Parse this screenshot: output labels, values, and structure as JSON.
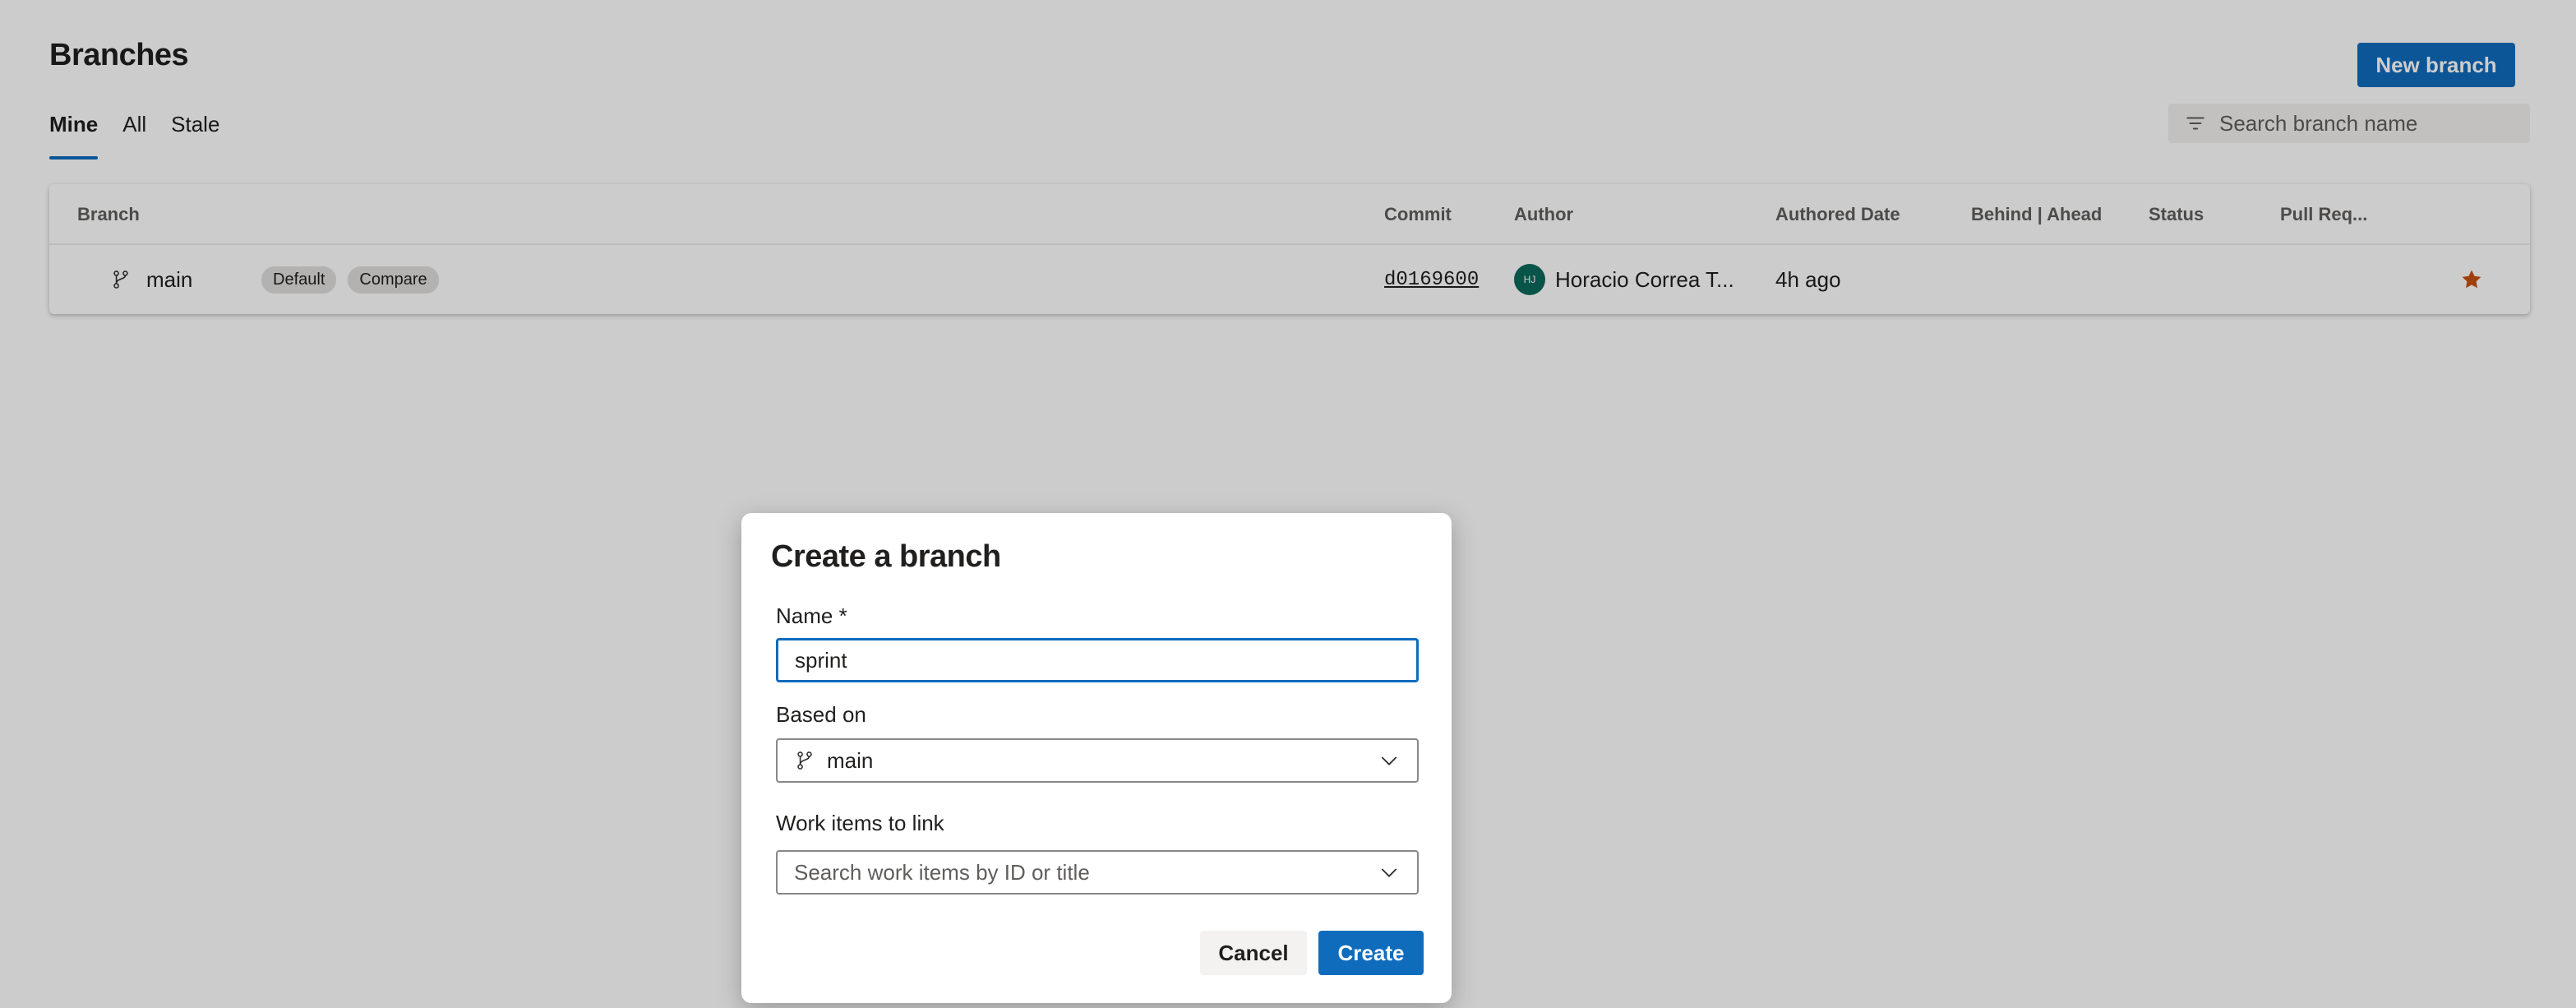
{
  "page": {
    "title": "Branches",
    "new_branch_label": "New branch",
    "tabs": [
      {
        "label": "Mine",
        "active": true
      },
      {
        "label": "All",
        "active": false
      },
      {
        "label": "Stale",
        "active": false
      }
    ],
    "search": {
      "placeholder": "Search branch name",
      "icon": "filter-icon"
    }
  },
  "table": {
    "columns": [
      "Branch",
      "Commit",
      "Author",
      "Authored Date",
      "Behind | Ahead",
      "Status",
      "Pull Req..."
    ],
    "rows": [
      {
        "branch": "main",
        "badges": [
          "Default",
          "Compare"
        ],
        "commit": "d0169600",
        "author_initials": "HJ",
        "author": "Horacio Correa T...",
        "authored_date": "4h ago",
        "favorite": true
      }
    ]
  },
  "dialog": {
    "title": "Create a branch",
    "name_label": "Name *",
    "name_value": "sprint",
    "based_on_label": "Based on",
    "based_on_value": "main",
    "work_items_label": "Work items to link",
    "work_items_placeholder": "Search work items by ID or title",
    "cancel_label": "Cancel",
    "create_label": "Create"
  },
  "colors": {
    "accent": "#0f6cbd",
    "avatar": "#0b6a5a",
    "star": "#ca5010"
  }
}
